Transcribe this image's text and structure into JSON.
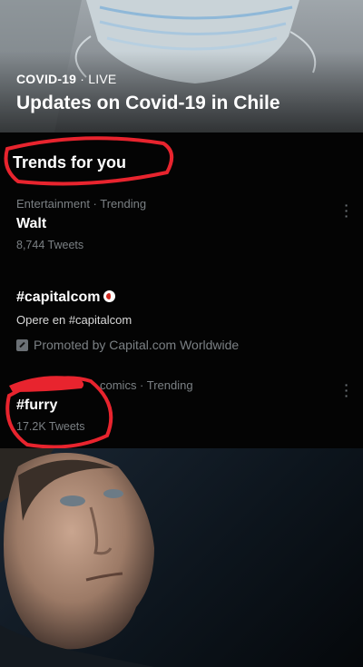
{
  "banner": {
    "category": "COVID-19",
    "separator": "·",
    "status": "LIVE",
    "title": "Updates on Covid-19 in Chile"
  },
  "trends": {
    "section_title": "Trends for you",
    "items": [
      {
        "meta": "Entertainment · Trending",
        "name": "Walt",
        "count": "8,744 Tweets"
      },
      {
        "name": "#capitalcom",
        "description": "Opere en #capitalcom",
        "promoted": "Promoted by Capital.com Worldwide"
      },
      {
        "meta": "comics · Trending",
        "name": "#furry",
        "count": "17.2K Tweets"
      }
    ]
  },
  "colors": {
    "annotation": "#e8242e",
    "muted_text": "#7b8084",
    "background": "#000000"
  },
  "icons": [
    "more-options-icon",
    "promoted-icon",
    "capitalcom-logo-icon"
  ]
}
